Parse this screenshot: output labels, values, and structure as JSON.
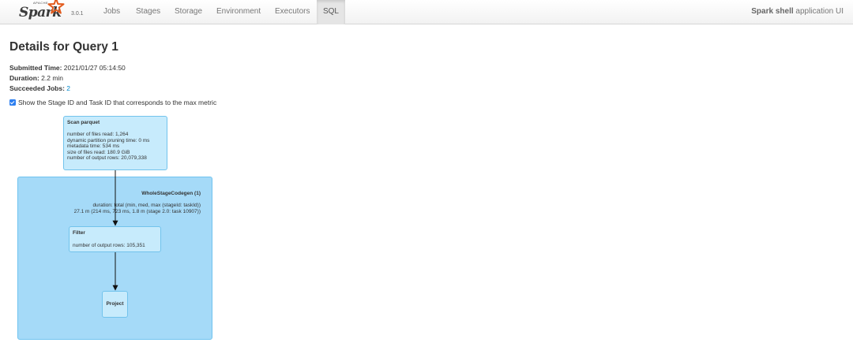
{
  "navbar": {
    "brand": {
      "apache": "APACHE",
      "name": "Spark",
      "version": "3.0.1"
    },
    "tabs": [
      {
        "label": "Jobs",
        "active": false
      },
      {
        "label": "Stages",
        "active": false
      },
      {
        "label": "Storage",
        "active": false
      },
      {
        "label": "Environment",
        "active": false
      },
      {
        "label": "Executors",
        "active": false
      },
      {
        "label": "SQL",
        "active": true
      }
    ],
    "app_title_bold": "Spark shell",
    "app_title_rest": " application UI"
  },
  "page": {
    "title": "Details for Query 1",
    "submitted_label": "Submitted Time:",
    "submitted_value": " 2021/01/27 05:14:50",
    "duration_label": "Duration:",
    "duration_value": " 2.2 min",
    "succeeded_label": "Succeeded Jobs:",
    "succeeded_value": "2",
    "show_max_metric_checked": true,
    "show_max_metric_label": "Show the Stage ID and Task ID that corresponds to the max metric"
  },
  "plan": {
    "scan": {
      "title": "Scan parquet",
      "metrics": [
        "number of files read: 1,264",
        "dynamic partition pruning time: 0 ms",
        "metadata time: 534 ms",
        "size of files read: 180.9 GiB",
        "number of output rows: 20,079,338"
      ]
    },
    "codegen": {
      "title": "WholeStageCodegen (1)",
      "metrics": [
        "duration: total (min, med, max (stageId: taskId))",
        "27.1 m (214 ms, 723 ms, 1.8 m (stage 2.0: task 10907))"
      ]
    },
    "filter": {
      "title": "Filter",
      "metrics": [
        "number of output rows: 105,351"
      ]
    },
    "project": {
      "title": "Project"
    }
  },
  "colors": {
    "cluster_fill": "#a5daf8",
    "node_fill": "#c7ebfc",
    "node_border": "#72c3ec",
    "link": "#0088cc",
    "spark_orange": "#e25a1c"
  }
}
